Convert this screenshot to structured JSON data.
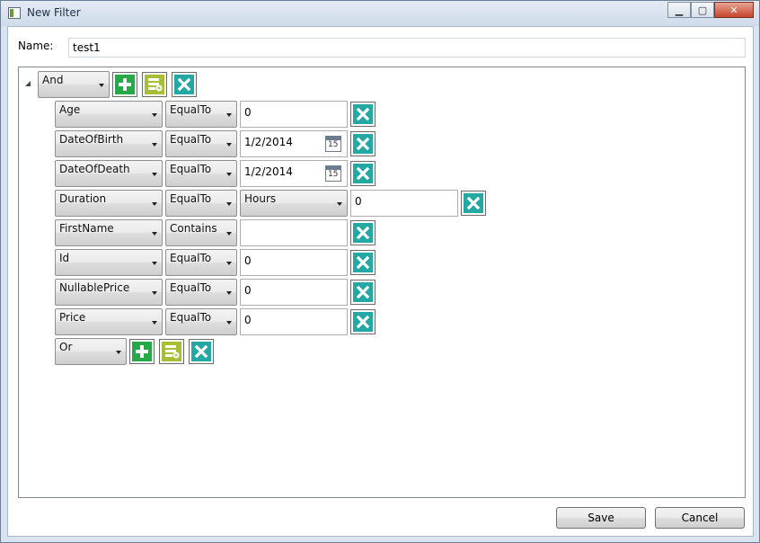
{
  "window": {
    "title": "New Filter"
  },
  "form": {
    "name_label": "Name:",
    "name_value": "test1"
  },
  "root_group": {
    "operator": "And"
  },
  "conditions": [
    {
      "field": "Age",
      "operator": "EqualTo",
      "value": "0"
    },
    {
      "field": "DateOfBirth",
      "operator": "EqualTo",
      "value": "1/2/2014",
      "calendar_day": "15"
    },
    {
      "field": "DateOfDeath",
      "operator": "EqualTo",
      "value": "1/2/2014",
      "calendar_day": "15"
    },
    {
      "field": "Duration",
      "operator": "EqualTo",
      "unit": "Hours",
      "value": "0"
    },
    {
      "field": "FirstName",
      "operator": "Contains",
      "value": ""
    },
    {
      "field": "Id",
      "operator": "EqualTo",
      "value": "0"
    },
    {
      "field": "NullablePrice",
      "operator": "EqualTo",
      "value": "0"
    },
    {
      "field": "Price",
      "operator": "EqualTo",
      "value": "0"
    }
  ],
  "sub_group": {
    "operator": "Or"
  },
  "footer": {
    "save_label": "Save",
    "cancel_label": "Cancel"
  },
  "colors": {
    "remove": "#23a8a3",
    "add": "#27a849",
    "add_group": "#a6bf36"
  },
  "icons": {
    "add": "plus-icon",
    "add_group": "add-group-icon",
    "remove": "close-icon",
    "calendar": "calendar-icon"
  }
}
